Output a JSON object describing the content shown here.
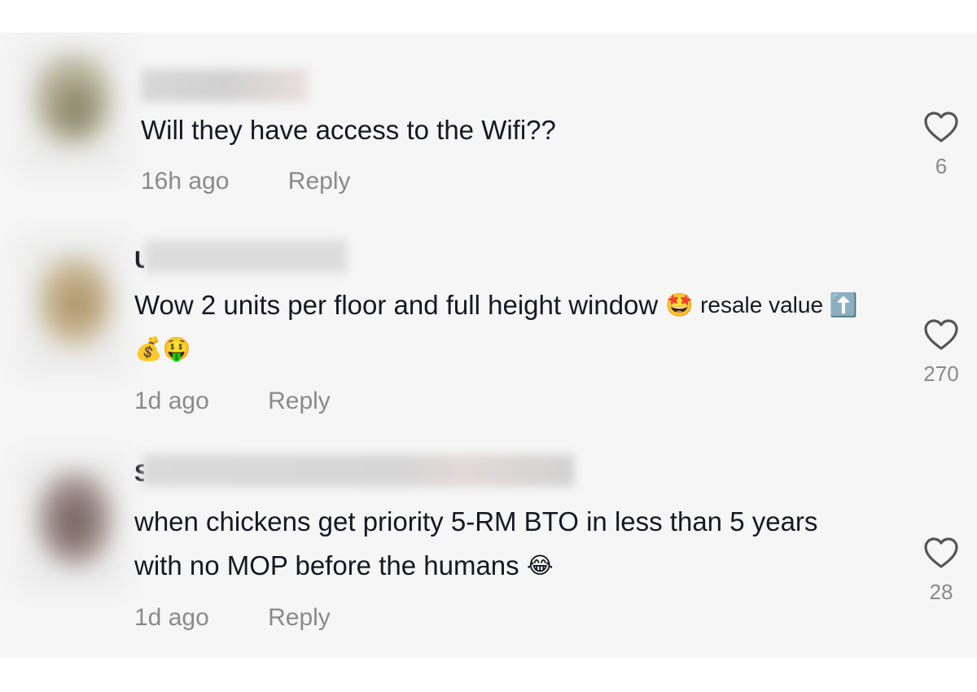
{
  "comments": [
    {
      "username_initial": "",
      "text": "Will they have access to the Wifi??",
      "emojis": "",
      "time": "16h ago",
      "reply_label": "Reply",
      "like_count": "6"
    },
    {
      "username_initial": "U",
      "text": "Wow 2 units per floor and full height window",
      "emojis": "🤩 resale value ⬆️💰🤑",
      "time": "1d ago",
      "reply_label": "Reply",
      "like_count": "270"
    },
    {
      "username_initial": "S",
      "text": "when chickens get priority 5-RM BTO in less than 5 years with no MOP before the humans",
      "emojis": "😂",
      "time": "1d ago",
      "reply_label": "Reply",
      "like_count": "28"
    }
  ],
  "icons": {
    "like": "heart-outline-icon"
  },
  "colors": {
    "background": "#f6f6f6",
    "text": "#161823",
    "muted": "#8a8a8a"
  }
}
